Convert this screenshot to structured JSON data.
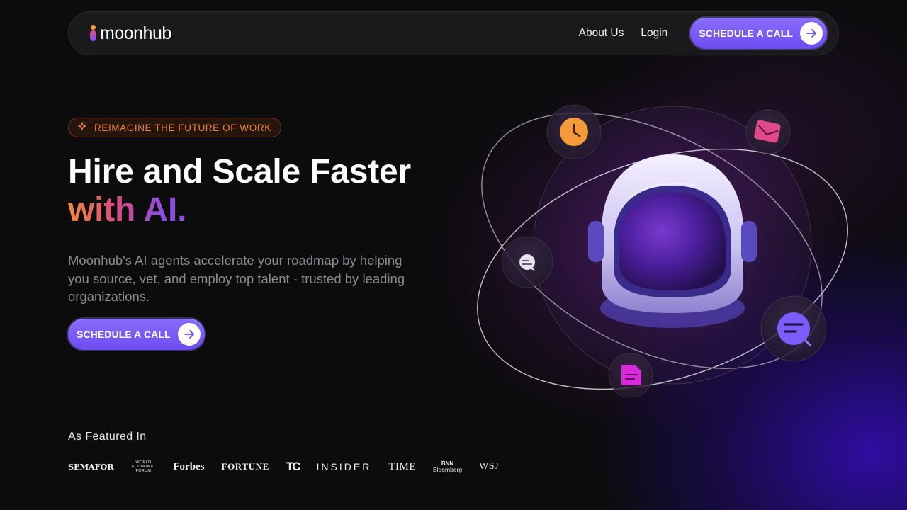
{
  "nav": {
    "logo_text": "moonhub",
    "links": [
      "About Us",
      "Login"
    ],
    "cta_label": "SCHEDULE A CALL",
    "cta_icon": "arrow-right-icon"
  },
  "hero": {
    "pill_icon": "sparkle-icon",
    "pill_text": "REIMAGINE THE FUTURE OF WORK",
    "title_line1": "Hire and Scale Faster",
    "title_line2": "with AI.",
    "description": "Moonhub's AI agents accelerate your roadmap by helping you source, vet, and employ top talent - trusted by leading organizations.",
    "cta_label": "SCHEDULE A CALL",
    "cta_icon": "arrow-right-icon"
  },
  "featured": {
    "title": "As Featured In",
    "logos": {
      "semafor": "SEMAFOR",
      "wef": [
        "WORLD",
        "ECONOMIC",
        "FORUM"
      ],
      "forbes": "Forbes",
      "fortune": "FORTUNE",
      "techcrunch": "TC",
      "insider": "INSIDER",
      "time": "TIME",
      "bnn_top": "BNN",
      "bnn_bottom": "Bloomberg",
      "wsj": "WSJ"
    }
  },
  "illustration": {
    "icons": [
      "clock-icon",
      "mail-icon",
      "chat-icon",
      "search-icon",
      "document-icon"
    ]
  },
  "colors": {
    "accent": "#7b5cff",
    "orange": "#f0823c",
    "pink": "#d84c7c",
    "purple": "#8b4fe0",
    "background": "#0c0c0d"
  }
}
